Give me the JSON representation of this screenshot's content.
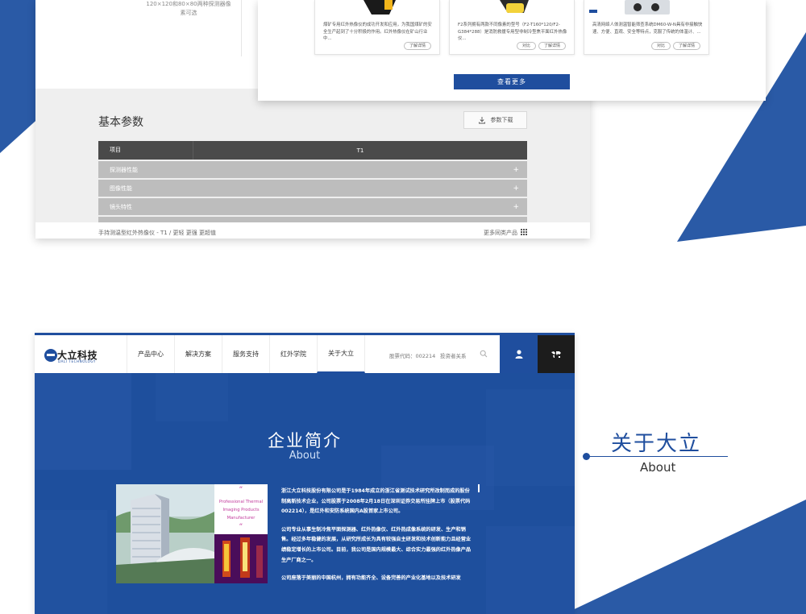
{
  "colors": {
    "brand_blue": "#1f4e9e",
    "dark": "#1c1c1c",
    "table_head": "#4a4a4a",
    "table_row": "#bdbdbd"
  },
  "param_page": {
    "caption_line1": "120×120和80×80两种探测器像",
    "caption_line2": "素可选",
    "title": "基本参数",
    "download_label": "参数下载",
    "download_icon": "download-icon",
    "table_header": {
      "col1": "项目",
      "col2": "T1"
    },
    "rows": [
      {
        "label": "探测器性能",
        "toggle": "+"
      },
      {
        "label": "图像性能",
        "toggle": "+"
      },
      {
        "label": "镜头特性",
        "toggle": "+"
      }
    ],
    "footer_text": "手持测温型红外热像仪 - T1 / 更轻 更强 更超值",
    "footer_more": "更多同类产品",
    "footer_icon": "grid-icon"
  },
  "related": {
    "products": [
      {
        "desc": "煤矿专用红外热像仪的成功开发和应用，为我国煤矿的安全生产起到了十分积极的作用。红外热像仪在矿山行业中...",
        "compare": "对比",
        "details": "了解详情"
      },
      {
        "desc": "F2系列拥有两款不同像素的型号（F2-T160*120/F2-G384*288）是消防救援专用型非制冷型焦平面红外热像仪...",
        "compare": "对比",
        "details": "了解详情"
      },
      {
        "desc": "高清网络人体测温智能筛查系统DM60-W-N具有非接触快速、方便、直观、安全等特点，克服了传统的体温计、...",
        "compare": "对比",
        "details": "了解详情"
      }
    ],
    "more_label": "查看更多"
  },
  "site": {
    "logo_cn": "大立科技",
    "logo_en": "DALI TECHNOLOGY",
    "menu": [
      {
        "label": "产品中心"
      },
      {
        "label": "解决方案"
      },
      {
        "label": "服务支持"
      },
      {
        "label": "红外学院"
      },
      {
        "label": "关于大立"
      }
    ],
    "stock_label": "股票代码：002214",
    "investor_label": "投资者关系",
    "icons": {
      "search": "search-icon",
      "user": "user-icon",
      "globe": "world-map-icon"
    },
    "hero_title": "企业简介",
    "hero_sub": "About",
    "card_quote_open": "“",
    "card_quote_close": "“",
    "card_text": [
      "Professional Thermal",
      "Imaging Products",
      "Manufacturer"
    ],
    "intro_p1": "浙江大立科技股份有限公司是于1984年成立的浙江省测试技术研究所改制而成的股份制高新技术企业，公司股票于2008年2月18日在深圳证券交易所挂牌上市（股票代码002214），是红外和安防系统国内A股首家上市公司。",
    "intro_p2": "公司专业从事生制冷焦平面探测器、红外热像仪、红外热成像系统的研发、生产和销售。经过多年稳健的发展，从研究所成长为具有较强自主研发和技术创新能力且经营业绩稳定增长的上市公司。目前，我公司是国内规模最大、综合实力最强的红外热像产品生产厂商之一。",
    "intro_p3": "公司座落于美丽的中国杭州，拥有功能齐全、设备完善的产业化基地以及技术研发"
  },
  "about_label": {
    "cn": "关于大立",
    "en": "About"
  }
}
